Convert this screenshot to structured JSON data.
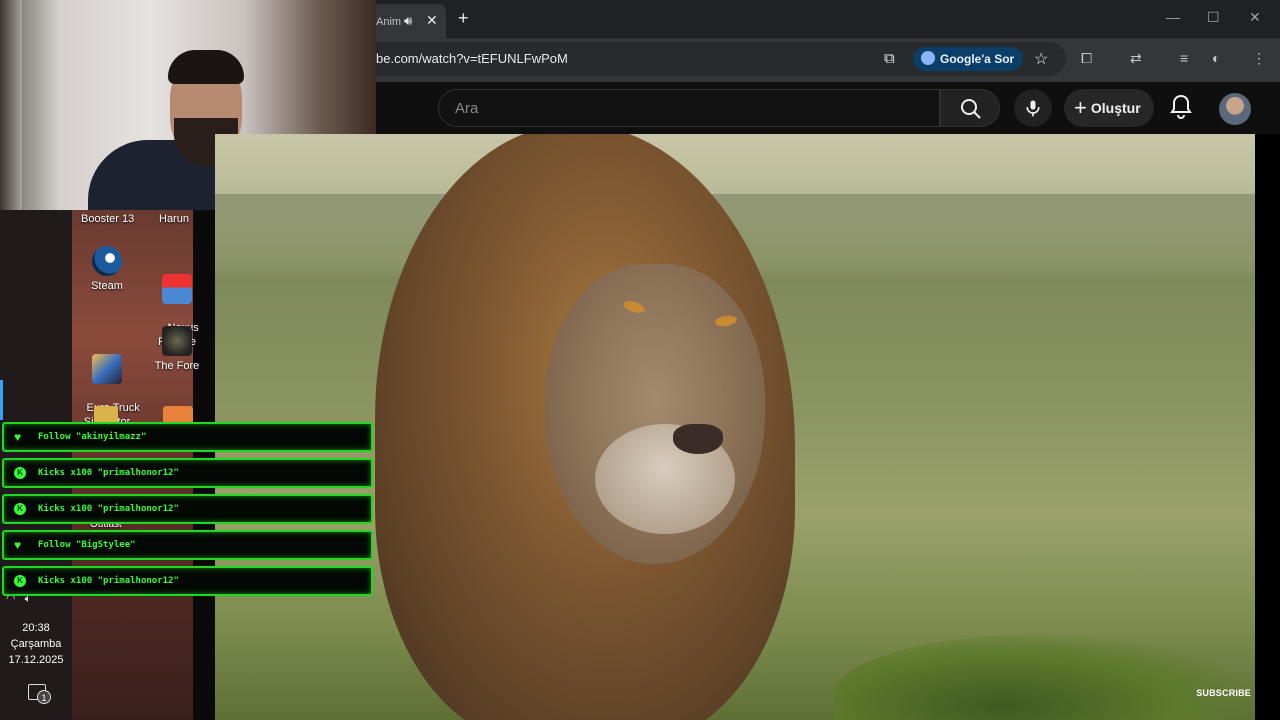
{
  "browser": {
    "tab_title": "Anim",
    "url": "be.com/watch?v=tEFUNLFwPoM",
    "google_button": "Google'a Sor"
  },
  "youtube": {
    "search_placeholder": "Ara",
    "create_label": "Oluştur",
    "subscribe_watermark": "SUBSCRIBE"
  },
  "desktop": {
    "top_labels": [
      "Booster 13",
      "Harun"
    ],
    "icons": [
      {
        "label": "Steam",
        "icon": "steam-icon"
      },
      {
        "label": "Nexus\nRumble",
        "icon": "nexus-icon"
      },
      {
        "label": "Euro Truck\nSimulator",
        "icon": "euro-truck-icon"
      },
      {
        "label": "The Fore",
        "icon": "forest-icon"
      }
    ],
    "partial_label": "Outlast"
  },
  "clock": {
    "time": "20:38",
    "day": "Çarşamba",
    "date": "17.12.2025",
    "notification_count": "1"
  },
  "alerts": [
    {
      "type": "follow",
      "icon": "heart-icon",
      "text": "Follow \"akinyilmazz\""
    },
    {
      "type": "kicks",
      "icon": "kicks-icon",
      "text": "Kicks x100 \"primalhonor12\""
    },
    {
      "type": "kicks",
      "icon": "kicks-icon",
      "text": "Kicks x100 \"primalhonor12\""
    },
    {
      "type": "follow",
      "icon": "heart-icon",
      "text": "Follow \"BigStylee\""
    },
    {
      "type": "kicks",
      "icon": "kicks-icon",
      "text": "Kicks x100 \"primalhonor12\""
    }
  ],
  "colors": {
    "alert_border": "#1fd81f",
    "alert_text": "#33ff33",
    "google_button_bg": "#0b3f67"
  }
}
